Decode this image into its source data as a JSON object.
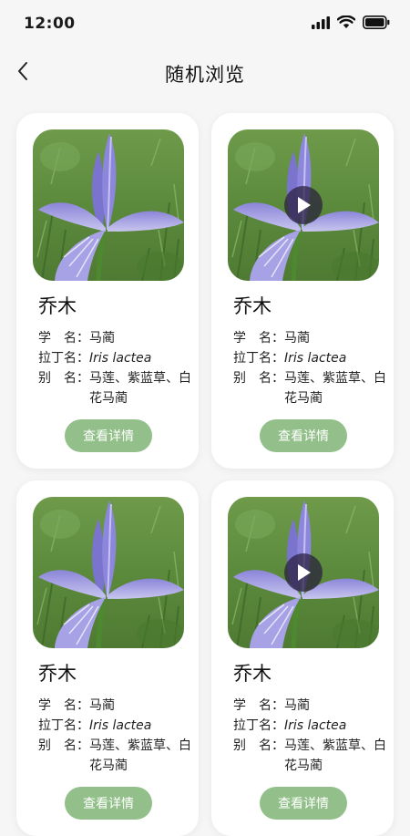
{
  "status_bar": {
    "time": "12:00"
  },
  "header": {
    "back_icon": "chevron-left-icon",
    "title": "随机浏览"
  },
  "cards": [
    {
      "title": "乔木",
      "scientific_label": "学　名：",
      "scientific_value": "马蔺",
      "latin_label": "拉丁名：",
      "latin_value": "Iris lactea",
      "alias_label": "别　名：",
      "alias_value": "马莲、紫蓝草、白花马蔺",
      "button": "查看详情",
      "has_video": false
    },
    {
      "title": "乔木",
      "scientific_label": "学　名：",
      "scientific_value": "马蔺",
      "latin_label": "拉丁名：",
      "latin_value": "Iris lactea",
      "alias_label": "别　名：",
      "alias_value": "马莲、紫蓝草、白花马蔺",
      "button": "查看详情",
      "has_video": true
    },
    {
      "title": "乔木",
      "scientific_label": "学　名：",
      "scientific_value": "马蔺",
      "latin_label": "拉丁名：",
      "latin_value": "Iris lactea",
      "alias_label": "别　名：",
      "alias_value": "马莲、紫蓝草、白花马蔺",
      "button": "查看详情",
      "has_video": false
    },
    {
      "title": "乔木",
      "scientific_label": "学　名：",
      "scientific_value": "马蔺",
      "latin_label": "拉丁名：",
      "latin_value": "Iris lactea",
      "alias_label": "别　名：",
      "alias_value": "马莲、紫蓝草、白花马蔺",
      "button": "查看详情",
      "has_video": true
    }
  ],
  "colors": {
    "accent": "#93c08a",
    "background": "#f6f6f6",
    "card": "#ffffff"
  }
}
